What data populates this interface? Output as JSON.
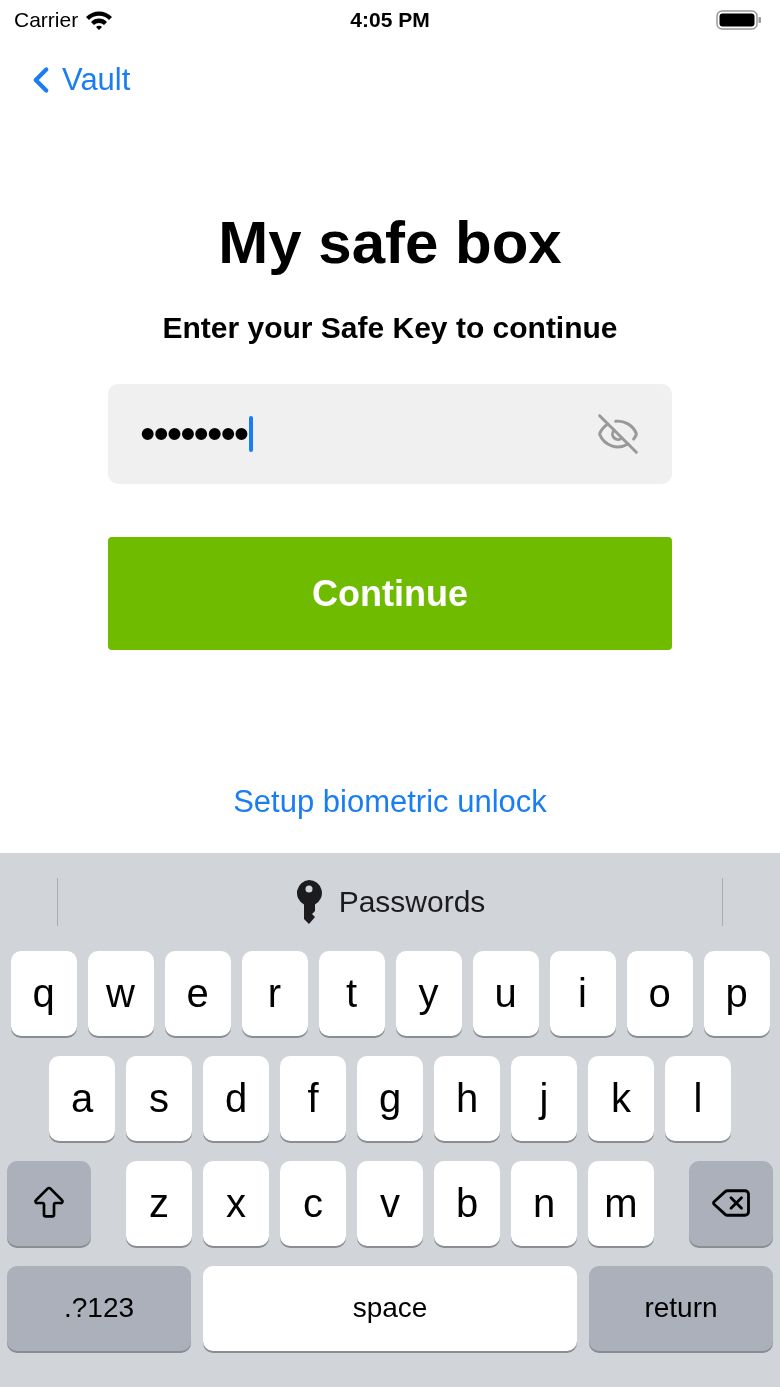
{
  "status_bar": {
    "carrier": "Carrier",
    "time": "4:05 PM"
  },
  "nav": {
    "back_label": "Vault"
  },
  "title": "My safe box",
  "subtitle": "Enter your Safe Key to continue",
  "key_field": {
    "value": "••••••••",
    "focused": true
  },
  "continue_button": "Continue",
  "biometric_link": "Setup biometric unlock",
  "keyboard": {
    "suggestion": "Passwords",
    "rows": [
      [
        {
          "kind": "letter",
          "label": "q"
        },
        {
          "kind": "letter",
          "label": "w"
        },
        {
          "kind": "letter",
          "label": "e"
        },
        {
          "kind": "letter",
          "label": "r"
        },
        {
          "kind": "letter",
          "label": "t"
        },
        {
          "kind": "letter",
          "label": "y"
        },
        {
          "kind": "letter",
          "label": "u"
        },
        {
          "kind": "letter",
          "label": "i"
        },
        {
          "kind": "letter",
          "label": "o"
        },
        {
          "kind": "letter",
          "label": "p"
        }
      ],
      [
        {
          "kind": "letter",
          "label": "a"
        },
        {
          "kind": "letter",
          "label": "s"
        },
        {
          "kind": "letter",
          "label": "d"
        },
        {
          "kind": "letter",
          "label": "f"
        },
        {
          "kind": "letter",
          "label": "g"
        },
        {
          "kind": "letter",
          "label": "h"
        },
        {
          "kind": "letter",
          "label": "j"
        },
        {
          "kind": "letter",
          "label": "k"
        },
        {
          "kind": "letter",
          "label": "l"
        }
      ],
      [
        {
          "kind": "shift"
        },
        {
          "kind": "letter",
          "label": "z"
        },
        {
          "kind": "letter",
          "label": "x"
        },
        {
          "kind": "letter",
          "label": "c"
        },
        {
          "kind": "letter",
          "label": "v"
        },
        {
          "kind": "letter",
          "label": "b"
        },
        {
          "kind": "letter",
          "label": "n"
        },
        {
          "kind": "letter",
          "label": "m"
        },
        {
          "kind": "backspace"
        }
      ]
    ],
    "bottom_keys": [
      {
        "kind": "mode",
        "label": ".?123"
      },
      {
        "kind": "space",
        "label": "space"
      },
      {
        "kind": "return",
        "label": "return"
      }
    ]
  }
}
